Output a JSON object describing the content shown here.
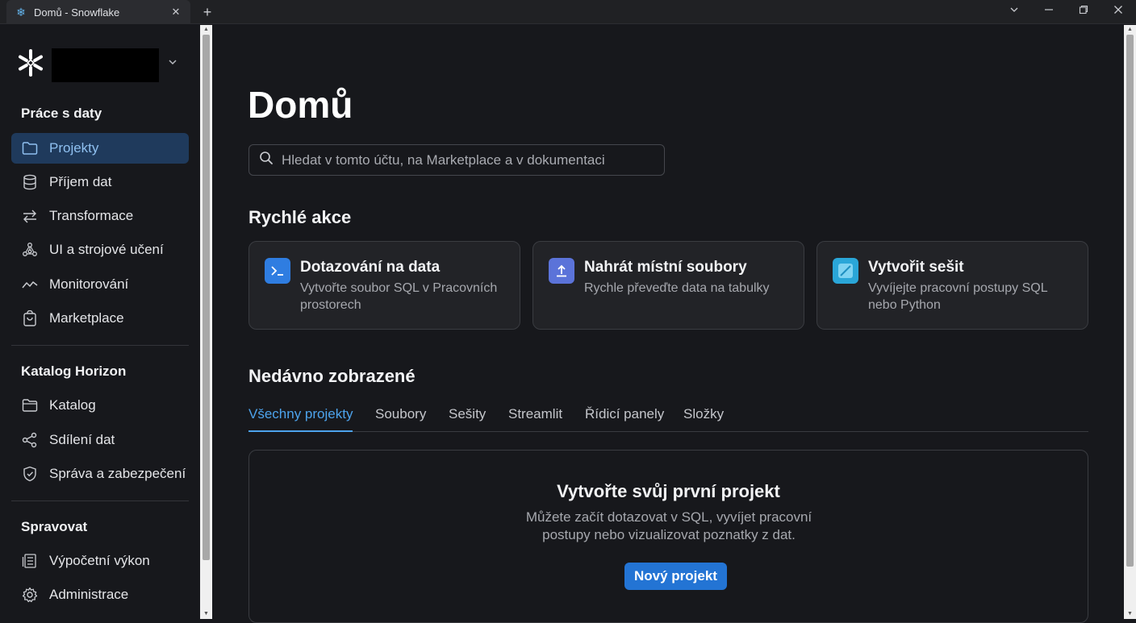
{
  "browser": {
    "tab_title": "Domů - Snowflake",
    "favicon": "snowflake-icon",
    "new_tab": "+",
    "close": "✕"
  },
  "sidebar": {
    "sections": [
      {
        "title": "Práce s daty"
      },
      {
        "title": "Katalog Horizon"
      },
      {
        "title": "Spravovat"
      }
    ],
    "items": [
      {
        "label": "Projekty",
        "icon": "folder-icon",
        "active": true
      },
      {
        "label": "Příjem dat",
        "icon": "database-icon"
      },
      {
        "label": "Transformace",
        "icon": "arrows-swap-icon"
      },
      {
        "label": "UI a strojové učení",
        "icon": "ai-network-icon"
      },
      {
        "label": "Monitorování",
        "icon": "activity-icon"
      },
      {
        "label": "Marketplace",
        "icon": "shopping-bag-icon"
      },
      {
        "label": "Katalog",
        "icon": "folder-icon"
      },
      {
        "label": "Sdílení dat",
        "icon": "share-icon"
      },
      {
        "label": "Správa a zabezpečení",
        "icon": "shield-icon"
      },
      {
        "label": "Výpočetní výkon",
        "icon": "compute-icon"
      },
      {
        "label": "Administrace",
        "icon": "gear-icon"
      }
    ]
  },
  "main": {
    "title": "Domů",
    "search_placeholder": "Hledat v tomto účtu, na Marketplace a v dokumentaci",
    "quick_actions_title": "Rychlé akce",
    "quick_actions": [
      {
        "title": "Dotazování na data",
        "desc": "Vytvořte soubor SQL v Pracovních prostorech",
        "icon": "terminal-icon",
        "color": "#2f7de1"
      },
      {
        "title": "Nahrát místní soubory",
        "desc": "Rychle převeďte data na tabulky",
        "icon": "upload-icon",
        "color": "#5b73d9"
      },
      {
        "title": "Vytvořit sešit",
        "desc": "Vyvíjejte pracovní postupy SQL nebo Python",
        "icon": "notebook-icon",
        "color": "#2aa6d8"
      }
    ],
    "recent_title": "Nedávno zobrazené",
    "tabs": [
      "Všechny projekty",
      "Soubory",
      "Sešity",
      "Streamlit",
      "Řídicí panely",
      "Složky"
    ],
    "empty_state": {
      "title": "Vytvořte svůj první projekt",
      "desc": "Můžete začít dotazovat v SQL, vyvíjet pracovní postupy nebo vizualizovat poznatky z dat.",
      "button": "Nový projekt"
    }
  },
  "colors": {
    "accent": "#4da3ec",
    "active_bg": "#1f3a5c",
    "primary_button": "#2374d4"
  }
}
